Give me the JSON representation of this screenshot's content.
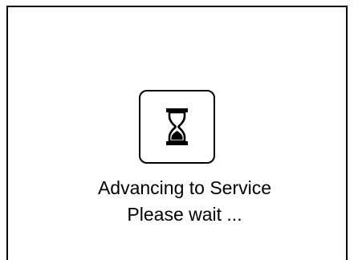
{
  "dialog": {
    "icon": "hourglass-icon",
    "message_line1": "Advancing to Service",
    "message_line2": "Please wait ..."
  },
  "colors": {
    "background": "#ffffff",
    "foreground": "#000000"
  }
}
